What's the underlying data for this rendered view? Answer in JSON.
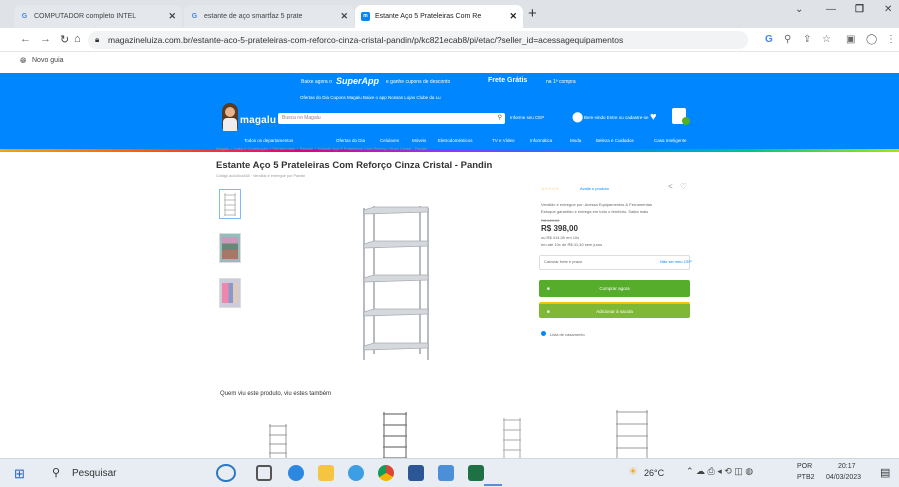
{
  "browser": {
    "tabs": [
      {
        "label": "COMPUTADOR completo INTEL",
        "icon": "google-icon",
        "active": false
      },
      {
        "label": "estante de aço smartfaz 5 prate",
        "icon": "google-icon",
        "active": false
      },
      {
        "label": "Estante Aço 5 Prateleiras Com Re",
        "icon": "magalu-icon",
        "active": true
      }
    ],
    "url": "magazineluiza.com.br/estante-aco-5-prateleiras-com-reforco-cinza-cristal-pandin/p/kc821ecab8/pi/etac/?seller_id=acessagequipamentos",
    "bookmark": "Novo guia"
  },
  "site": {
    "topbar": {
      "prefix": "Baixe agora o",
      "brand": "SuperApp",
      "offer": "Frete Grátis",
      "middle": "e ganhe cupons de desconto",
      "suffix": "na 1ª compra"
    },
    "header_links": "Ofertas do Dia  Cupons Magalu  Baixe o app  Nossas Lojas  Clube da Lu",
    "logo": "magalu",
    "search_placeholder": "Busca no Magalu",
    "cep_label": "Informe seu CEP",
    "account_label": "Bem-vindo Entre ou cadastre-se",
    "categories": [
      "Todos os departamentos",
      "Ofertas do Dia",
      "Celulares",
      "Móveis",
      "Eletrodomésticos",
      "TV e Vídeo",
      "Informática",
      "Moda",
      "Beleza e Cuidados",
      "Casa Inteligente"
    ]
  },
  "product": {
    "breadcrumb": "Magalu > Casa e Construção > Ferramentas > Estante > Estante Aço 5 Prateleiras Com Reforço Cinza Cristal - Pandin",
    "title": "Estante Aço 5 Prateleiras Com Reforço Cinza Cristal - Pandin",
    "subinfo": "Código ac4c5c4d38 · Vendido e entregue por Pandin",
    "rating_text": "Avalie o produto",
    "seller_text": "Vendido e entregue por: Acessa Equipamentos & Ferramentas",
    "seller_sub": "Estoque garantido e entrega em todo o território. Saiba mais",
    "old_price": "R$ 429,90",
    "price": "R$ 398,00",
    "price_sub": "ou R$ 414,00 em 10x",
    "installments": "em até 10x de R$ 41,40 sem juros",
    "cep_title": "Calcular frete e prazo",
    "cep_action": "Não sei meu CEP",
    "buy_label": "Comprar agora",
    "cart_label": "Adicionar à sacola",
    "wishlist": "Lista de casamento",
    "seen_title": "Quem viu este produto, viu estes também"
  },
  "taskbar": {
    "search": "Pesquisar",
    "temperature": "26°C",
    "lang": "POR",
    "lang2": "PTB2",
    "time": "20:17",
    "date": "04/03/2023"
  }
}
